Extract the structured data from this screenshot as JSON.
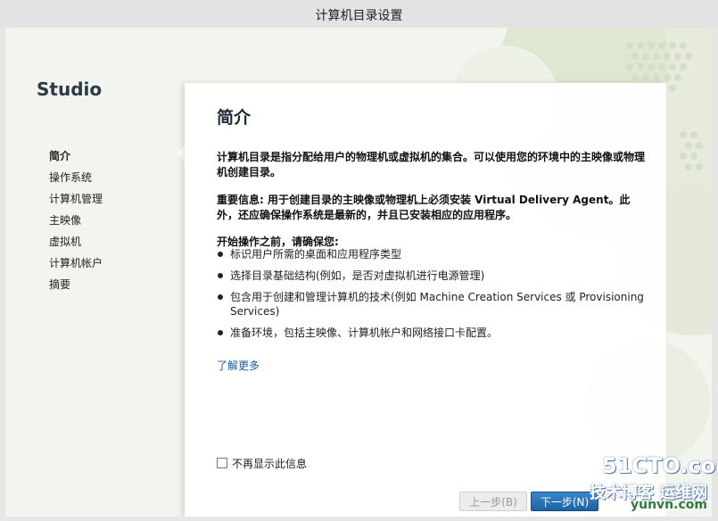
{
  "window": {
    "title": "计算机目录设置"
  },
  "sidebar": {
    "brand": "Studio",
    "items": [
      {
        "label": "简介",
        "active": true
      },
      {
        "label": "操作系统",
        "active": false
      },
      {
        "label": "计算机管理",
        "active": false
      },
      {
        "label": "主映像",
        "active": false
      },
      {
        "label": "虚拟机",
        "active": false
      },
      {
        "label": "计算机帐户",
        "active": false
      },
      {
        "label": "摘要",
        "active": false
      }
    ]
  },
  "main": {
    "heading": "简介",
    "intro": "计算机目录是指分配给用户的物理机或虚拟机的集合。可以使用您的环境中的主映像或物理机创建目录。",
    "important": "重要信息: 用于创建目录的主映像或物理机上必须安装 Virtual Delivery Agent。此外，还应确保操作系统是最新的，并且已安装相应的应用程序。",
    "before_start": "开始操作之前，请确保您:",
    "bullets": [
      "标识用户所需的桌面和应用程序类型",
      "选择目录基础结构(例如，是否对虚拟机进行电源管理)",
      "包含用于创建和管理计算机的技术(例如 Machine Creation Services 或 Provisioning Services)",
      "准备环境，包括主映像、计算机帐户和网络接口卡配置。"
    ],
    "learn_more": "了解更多",
    "dont_show_label": "不再显示此信息",
    "dont_show_checked": false
  },
  "footer": {
    "back_label": "上一步(B)",
    "next_label": "下一步(N)"
  },
  "watermark": {
    "site": "51CTO.com",
    "tagline": "技术博客",
    "partner": "运维网",
    "partner_url": "yunvn.com"
  },
  "colors": {
    "accent": "#1e62a5",
    "link": "#1a5aa6",
    "background": "#f2f4ee"
  }
}
